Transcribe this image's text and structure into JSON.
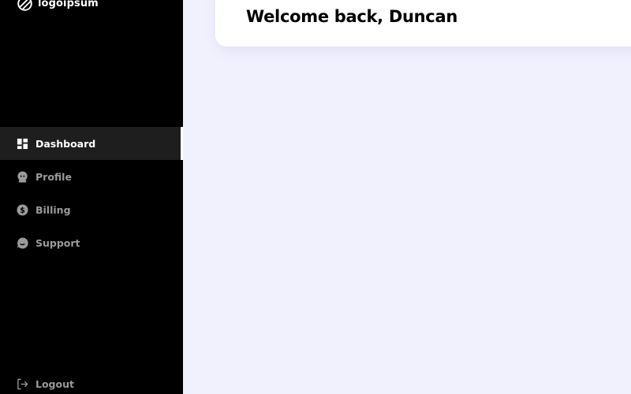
{
  "brand": {
    "name": "logoipsum"
  },
  "nav": {
    "items": [
      {
        "label": "Dashboard",
        "icon": "dashboard-icon",
        "active": true
      },
      {
        "label": "Profile",
        "icon": "profile-icon",
        "active": false
      },
      {
        "label": "Billing",
        "icon": "billing-icon",
        "active": false
      },
      {
        "label": "Support",
        "icon": "support-icon",
        "active": false
      }
    ],
    "logout_label": "Logout"
  },
  "header": {
    "greeting": "Welcome back, Duncan"
  },
  "colors": {
    "sidebar_bg": "#000000",
    "active_item_bg": "#1e1e1e",
    "inactive_text": "#9a9a9a",
    "page_bg": "#f1f1fe",
    "card_bg": "#ffffff"
  }
}
